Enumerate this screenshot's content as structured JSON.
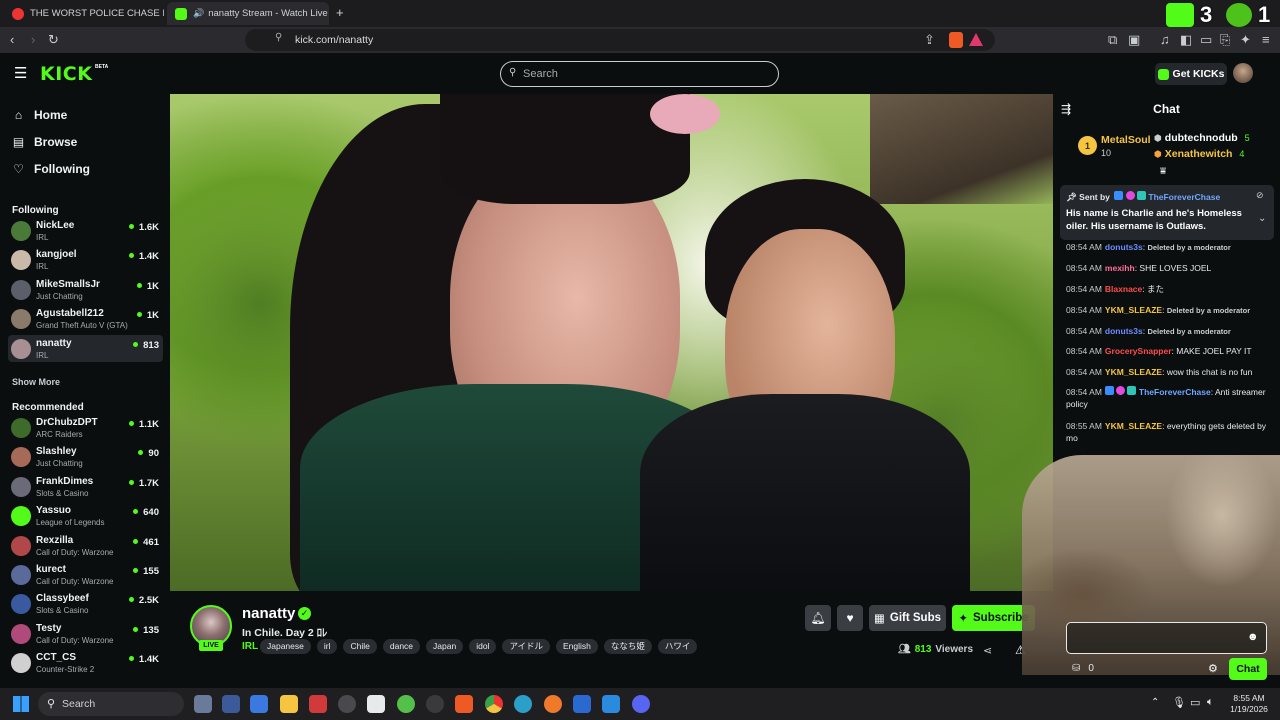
{
  "browser": {
    "tabs": [
      {
        "title": "THE WORST POLICE CHASE I'VE EVER",
        "active": false
      },
      {
        "title": "nanatty Stream - Watch Live o",
        "active": true
      }
    ],
    "new_tab": "+",
    "url": "kick.com/nanatty",
    "overlay_counts": [
      "3",
      "1"
    ]
  },
  "header": {
    "logo": "KICK",
    "logo_badge": "BETA",
    "search_placeholder": "Search",
    "get_kicks": "Get KICKs"
  },
  "sidebar": {
    "nav": [
      {
        "label": "Home",
        "icon": "home-icon"
      },
      {
        "label": "Browse",
        "icon": "browse-icon"
      },
      {
        "label": "Following",
        "icon": "heart-icon"
      }
    ],
    "following_title": "Following",
    "following": [
      {
        "name": "NickLee",
        "category": "IRL",
        "viewers": "1.6K",
        "color": "#4a7a3a"
      },
      {
        "name": "kangjoel",
        "category": "IRL",
        "viewers": "1.4K",
        "color": "#c9b9a8"
      },
      {
        "name": "MikeSmallsJr",
        "category": "Just Chatting",
        "viewers": "1K",
        "color": "#5a5f6a"
      },
      {
        "name": "Agustabell212",
        "category": "Grand Theft Auto V (GTA)",
        "viewers": "1K",
        "color": "#8a7a6a"
      },
      {
        "name": "nanatty",
        "category": "IRL",
        "viewers": "813",
        "color": "#a88f93"
      }
    ],
    "show_more": "Show More",
    "recommended_title": "Recommended",
    "recommended": [
      {
        "name": "DrChubzDPT",
        "category": "ARC Raiders",
        "viewers": "1.1K",
        "color": "#3e6b2a"
      },
      {
        "name": "Slashley",
        "category": "Just Chatting",
        "viewers": "90",
        "color": "#a86a58"
      },
      {
        "name": "FrankDimes",
        "category": "Slots & Casino",
        "viewers": "1.7K",
        "color": "#6a6a78"
      },
      {
        "name": "Yassuo",
        "category": "League of Legends",
        "viewers": "640",
        "color": "#53fc18"
      },
      {
        "name": "Rexzilla",
        "category": "Call of Duty: Warzone",
        "viewers": "461",
        "color": "#b0484a"
      },
      {
        "name": "kurect",
        "category": "Call of Duty: Warzone",
        "viewers": "155",
        "color": "#5a6a9a"
      },
      {
        "name": "Classybeef",
        "category": "Slots & Casino",
        "viewers": "2.5K",
        "color": "#3a5aa0"
      },
      {
        "name": "Testy",
        "category": "Call of Duty: Warzone",
        "viewers": "135",
        "color": "#b04a7a"
      },
      {
        "name": "CCT_CS",
        "category": "Counter-Strike 2",
        "viewers": "1.4K",
        "color": "#d0d0d0"
      }
    ]
  },
  "stream": {
    "overlay_name": "nanatty",
    "live_badge": "LIVE",
    "streamer": "nanatty",
    "title": "In Chile. Day 2 ﾛﾚ",
    "category": "IRL",
    "tags": [
      "Japanese",
      "irl",
      "Chile",
      "dance",
      "Japan",
      "idol",
      "アイドル",
      "English",
      "ななち姫",
      "ハワイ"
    ],
    "gift_subs": "Gift Subs",
    "subscribe": "Subscribe",
    "viewers_count": "813",
    "viewers_label": "Viewers"
  },
  "chat": {
    "title": "Chat",
    "leaderboard": [
      {
        "rank": "1",
        "name": "MetalSoul",
        "score": "10",
        "color": "#f5c542"
      },
      {
        "name": "dubtechnodub",
        "score": "5",
        "color": "#ffffff"
      },
      {
        "name": "Xenathewitch",
        "score": "4",
        "color": "#f5c542"
      }
    ],
    "pinned": {
      "sent_by_label": "Sent by",
      "user": "TheForeverChase",
      "text": "His name is Charlie and he's Homeless oiler. His username is Outlaws."
    },
    "messages": [
      {
        "time": "08:54 AM",
        "user": "donuts3s",
        "color": "#6e8cff",
        "text": "Deleted by a moderator",
        "deleted": true
      },
      {
        "time": "08:54 AM",
        "user": "mexihh",
        "color": "#ff6e9a",
        "text": "SHE LOVES JOEL",
        "deleted": false
      },
      {
        "time": "08:54 AM",
        "user": "Blaxnace",
        "color": "#ff4d4d",
        "text": "また",
        "deleted": false
      },
      {
        "time": "08:54 AM",
        "user": "YKM_SLEAZE",
        "color": "#f5c542",
        "text": "Deleted by a moderator",
        "deleted": true
      },
      {
        "time": "08:54 AM",
        "user": "donuts3s",
        "color": "#6e8cff",
        "text": "Deleted by a moderator",
        "deleted": true
      },
      {
        "time": "08:54 AM",
        "user": "GrocerySnapper",
        "color": "#ff4d4d",
        "text": "MAKE JOEL PAY IT",
        "deleted": false
      },
      {
        "time": "08:54 AM",
        "user": "YKM_SLEAZE",
        "color": "#f5c542",
        "text": "wow this chat is no fun",
        "deleted": false
      },
      {
        "time": "08:54 AM",
        "user": "TheForeverChase",
        "color": "#6ea8ff",
        "text": "Anti streamer policy",
        "deleted": false
      },
      {
        "time": "08:55 AM",
        "user": "YKM_SLEAZE",
        "color": "#f5c542",
        "text": "everything gets deleted by mo",
        "deleted": false
      }
    ],
    "points": "0",
    "chat_button": "Chat"
  },
  "taskbar": {
    "search": "Search",
    "time": "8:55 AM",
    "date": "1/19/2026"
  },
  "colors": {
    "accent": "#53fc18",
    "bg": "#0b0e0f"
  }
}
